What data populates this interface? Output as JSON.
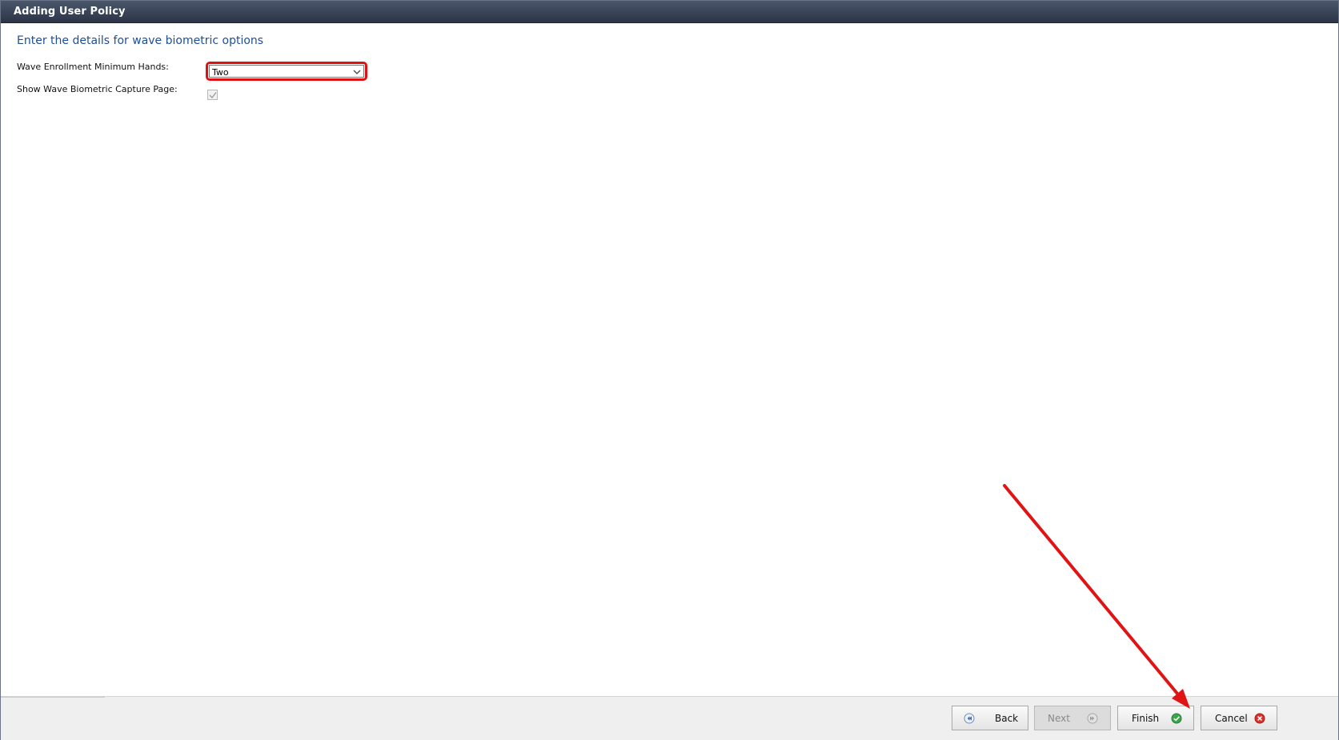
{
  "window": {
    "title": "Adding User Policy"
  },
  "content": {
    "heading": "Enter the details for wave biometric options",
    "fields": {
      "min_hands": {
        "label": "Wave Enrollment Minimum Hands:",
        "value": "Two"
      },
      "show_capture": {
        "label": "Show Wave Biometric Capture Page:",
        "checked": true
      }
    }
  },
  "footer": {
    "back_label": "Back",
    "next_label": "Next",
    "finish_label": "Finish",
    "cancel_label": "Cancel"
  },
  "colors": {
    "heading": "#1d4f98",
    "highlight": "#e01010",
    "finish_icon": "#3aa64a",
    "cancel_icon": "#d9312b"
  },
  "icons": {
    "back": "rewind-icon",
    "next": "fast-forward-icon",
    "finish": "check-circle-icon",
    "cancel": "close-circle-icon",
    "dropdown": "chevron-down-icon",
    "annotation": "red-arrow"
  }
}
